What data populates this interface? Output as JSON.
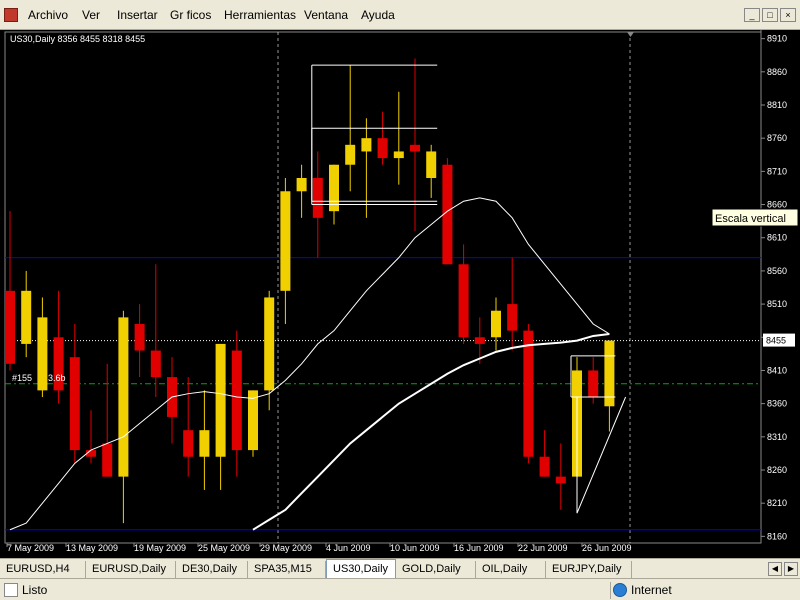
{
  "menu": {
    "items": [
      "Archivo",
      "Ver",
      "Insertar",
      "Gr ficos",
      "Herramientas",
      "Ventana",
      "Ayuda"
    ]
  },
  "window_buttons": [
    "_",
    "□",
    "×"
  ],
  "chart": {
    "header": "US30,Daily  8356 8455 8318 8455",
    "order_label": "#155",
    "order_label_suffix": "3.6b",
    "tooltip": "Escala vertical",
    "current_price": "8455",
    "colors": {
      "bull": "#f0d000",
      "bear": "#e00000",
      "grid": "#ffffff",
      "hline": "#0000ff",
      "level": "#00aa00"
    }
  },
  "chart_data": {
    "type": "candlestick",
    "title": "US30,Daily",
    "ohlc_header": {
      "open": 8356,
      "high": 8455,
      "low": 8318,
      "close": 8455
    },
    "y_ticks": [
      8910,
      8860,
      8810,
      8760,
      8710,
      8660,
      8610,
      8560,
      8510,
      8460,
      8410,
      8360,
      8310,
      8260,
      8210,
      8160
    ],
    "x_labels": [
      "7 May 2009",
      "13 May 2009",
      "19 May 2009",
      "25 May 2009",
      "29 May 2009",
      "4 Jun 2009",
      "10 Jun 2009",
      "16 Jun 2009",
      "22 Jun 2009",
      "26 Jun 2009"
    ],
    "ylim": [
      8150,
      8920
    ],
    "horizontal_lines": [
      {
        "price": 8580,
        "style": "solid",
        "color": "#0000ff"
      },
      {
        "price": 8170,
        "style": "solid",
        "color": "#0000ff"
      },
      {
        "price": 8455,
        "style": "dotted",
        "color": "#ffffff"
      },
      {
        "price": 8390,
        "style": "dash-dot",
        "color": "#00aa00"
      }
    ],
    "candles": [
      {
        "o": 8530,
        "h": 8650,
        "l": 8410,
        "c": 8420
      },
      {
        "o": 8450,
        "h": 8560,
        "l": 8430,
        "c": 8530
      },
      {
        "o": 8380,
        "h": 8520,
        "l": 8370,
        "c": 8490
      },
      {
        "o": 8460,
        "h": 8530,
        "l": 8360,
        "c": 8380
      },
      {
        "o": 8430,
        "h": 8480,
        "l": 8270,
        "c": 8290
      },
      {
        "o": 8290,
        "h": 8350,
        "l": 8270,
        "c": 8280
      },
      {
        "o": 8300,
        "h": 8420,
        "l": 8250,
        "c": 8250
      },
      {
        "o": 8250,
        "h": 8500,
        "l": 8180,
        "c": 8490
      },
      {
        "o": 8480,
        "h": 8510,
        "l": 8400,
        "c": 8440
      },
      {
        "o": 8440,
        "h": 8570,
        "l": 8370,
        "c": 8400
      },
      {
        "o": 8400,
        "h": 8430,
        "l": 8300,
        "c": 8340
      },
      {
        "o": 8320,
        "h": 8400,
        "l": 8250,
        "c": 8280
      },
      {
        "o": 8280,
        "h": 8380,
        "l": 8230,
        "c": 8320
      },
      {
        "o": 8280,
        "h": 8440,
        "l": 8230,
        "c": 8450
      },
      {
        "o": 8440,
        "h": 8470,
        "l": 8250,
        "c": 8290
      },
      {
        "o": 8290,
        "h": 8380,
        "l": 8280,
        "c": 8380
      },
      {
        "o": 8380,
        "h": 8530,
        "l": 8350,
        "c": 8520
      },
      {
        "o": 8530,
        "h": 8700,
        "l": 8480,
        "c": 8680
      },
      {
        "o": 8680,
        "h": 8720,
        "l": 8640,
        "c": 8700
      },
      {
        "o": 8700,
        "h": 8740,
        "l": 8580,
        "c": 8640
      },
      {
        "o": 8650,
        "h": 8720,
        "l": 8630,
        "c": 8720
      },
      {
        "o": 8720,
        "h": 8870,
        "l": 8680,
        "c": 8750
      },
      {
        "o": 8740,
        "h": 8790,
        "l": 8640,
        "c": 8760
      },
      {
        "o": 8760,
        "h": 8800,
        "l": 8720,
        "c": 8730
      },
      {
        "o": 8730,
        "h": 8830,
        "l": 8690,
        "c": 8740
      },
      {
        "o": 8750,
        "h": 8880,
        "l": 8620,
        "c": 8740
      },
      {
        "o": 8700,
        "h": 8750,
        "l": 8670,
        "c": 8740
      },
      {
        "o": 8720,
        "h": 8730,
        "l": 8610,
        "c": 8570
      },
      {
        "o": 8570,
        "h": 8600,
        "l": 8450,
        "c": 8460
      },
      {
        "o": 8460,
        "h": 8490,
        "l": 8420,
        "c": 8450
      },
      {
        "o": 8460,
        "h": 8520,
        "l": 8440,
        "c": 8500
      },
      {
        "o": 8510,
        "h": 8580,
        "l": 8440,
        "c": 8470
      },
      {
        "o": 8470,
        "h": 8480,
        "l": 8270,
        "c": 8280
      },
      {
        "o": 8280,
        "h": 8320,
        "l": 8250,
        "c": 8250
      },
      {
        "o": 8250,
        "h": 8300,
        "l": 8200,
        "c": 8240
      },
      {
        "o": 8250,
        "h": 8430,
        "l": 8210,
        "c": 8410
      },
      {
        "o": 8410,
        "h": 8430,
        "l": 8360,
        "c": 8370
      },
      {
        "o": 8356,
        "h": 8455,
        "l": 8318,
        "c": 8455
      }
    ],
    "moving_averages": [
      {
        "name": "",
        "color": "#ffffff",
        "width": 1,
        "values": [
          8170,
          8180,
          8210,
          8240,
          8270,
          8290,
          8300,
          8310,
          8330,
          8350,
          8370,
          8375,
          8378,
          8375,
          8370,
          8368,
          8375,
          8395,
          8420,
          8450,
          8470,
          8500,
          8530,
          8555,
          8580,
          8610,
          8630,
          8650,
          8665,
          8670,
          8665,
          8640,
          8600,
          8570,
          8540,
          8510,
          8480,
          8465
        ]
      },
      {
        "name": "",
        "color": "#ffffff",
        "width": 2,
        "values": [
          null,
          null,
          null,
          null,
          null,
          null,
          null,
          null,
          null,
          null,
          null,
          null,
          null,
          null,
          null,
          8170,
          8185,
          8200,
          8225,
          8250,
          8275,
          8300,
          8320,
          8340,
          8360,
          8375,
          8390,
          8405,
          8418,
          8428,
          8438,
          8444,
          8448,
          8450,
          8452,
          8455,
          8462,
          8465
        ]
      }
    ],
    "annotations": [
      {
        "type": "range-box",
        "from_index": 19,
        "to_index": 26,
        "low": 8665,
        "high": 8775
      },
      {
        "type": "range-box",
        "from_index": 19,
        "to_index": 26,
        "low": 8660,
        "high": 8870
      },
      {
        "type": "range-box",
        "from_index": 35,
        "to_index": 37,
        "low": 8370,
        "high": 8432
      },
      {
        "type": "triangle",
        "from_index": 35,
        "to_index": 38,
        "low": 8195,
        "high": 8370
      }
    ]
  },
  "tabs": {
    "items": [
      "EURUSD,H4",
      "EURUSD,Daily",
      "DE30,Daily",
      "SPA35,M15",
      "US30,Daily",
      "GOLD,Daily",
      "OIL,Daily",
      "EURJPY,Daily"
    ],
    "active_index": 4
  },
  "status": {
    "text": "Listo",
    "zone": "Internet"
  }
}
